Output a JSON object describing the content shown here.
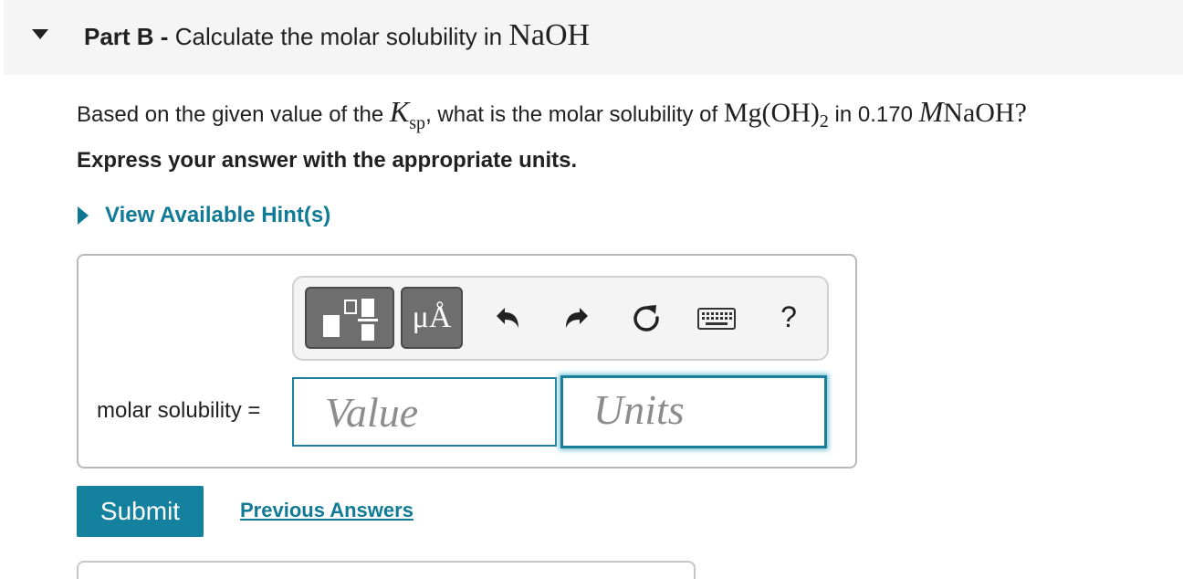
{
  "part": {
    "label": "Part B -",
    "title": "Calculate the molar solubility in",
    "title_formula": "NaOH"
  },
  "question": {
    "text_before": "Based on the given value of the",
    "k": "K",
    "k_sub": "sp",
    "text_mid": ", what is the molar solubility of",
    "compound": "Mg(OH)",
    "compound_sub": "2",
    "text_in": "in 0.170",
    "molarity_unit": "M",
    "solvent": "NaOH",
    "end": "?"
  },
  "instructions": "Express your answer with the appropriate units.",
  "hint": {
    "label": "View Available Hint(s)"
  },
  "toolbar": {
    "units_label": "μÅ",
    "help_label": "?",
    "icons": [
      "templates-icon",
      "undo-icon",
      "redo-icon",
      "reset-icon",
      "keyboard-icon"
    ]
  },
  "answer": {
    "label": "molar solubility =",
    "value_placeholder": "Value",
    "units_placeholder": "Units"
  },
  "actions": {
    "submit_label": "Submit",
    "previous_answers_label": "Previous Answers"
  },
  "colors": {
    "accent": "#14819f",
    "link": "#117a95",
    "header_bg": "#f5f5f5"
  }
}
